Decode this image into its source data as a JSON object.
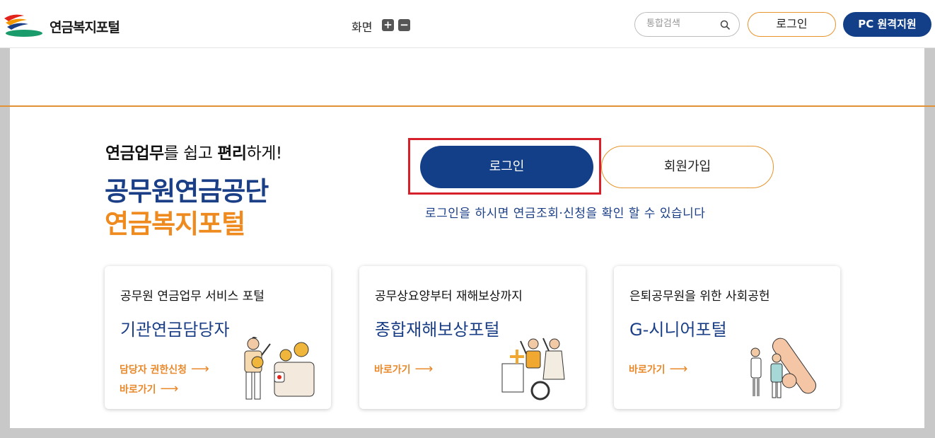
{
  "header": {
    "logo_text": "연금복지포털",
    "zoom_label": "화면",
    "zoom_in": "+",
    "zoom_out": "−",
    "search_placeholder": "통합검색",
    "login_label": "로그인",
    "remote_label": "PC 원격지원"
  },
  "hero": {
    "tagline_bold1": "연금업무",
    "tagline_mid": "를 쉽고 ",
    "tagline_bold2": "편리",
    "tagline_end": "하게!",
    "org_name": "공무원연금공단",
    "portal_name": "연금복지포털",
    "login_button": "로그인",
    "signup_button": "회원가입",
    "login_note": "로그인을 하시면 연금조회·신청을 확인 할 수 있습니다"
  },
  "cards": [
    {
      "subtitle": "공무원 연금업무 서비스 포털",
      "title": "기관연금담당자",
      "links": [
        "담당자 권한신청",
        "바로가기"
      ]
    },
    {
      "subtitle": "공무상요양부터 재해보상까지",
      "title": "종합재해보상포털",
      "links": [
        "바로가기"
      ]
    },
    {
      "subtitle": "은퇴공무원을 위한 사회공헌",
      "title": "G-시니어포털",
      "links": [
        "바로가기"
      ]
    }
  ],
  "colors": {
    "navy": "#123f87",
    "orange": "#ee8a1e",
    "highlight": "#d6202c"
  }
}
